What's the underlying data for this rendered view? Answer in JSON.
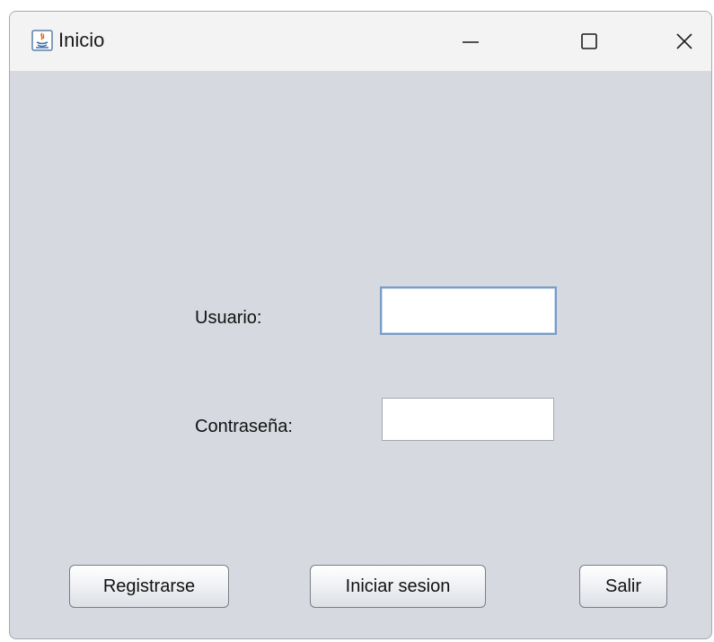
{
  "window": {
    "title": "Inicio",
    "icon": "java-icon",
    "controls": {
      "minimize": "minimize-icon",
      "maximize": "maximize-icon",
      "close": "close-icon"
    }
  },
  "form": {
    "user_label": "Usuario:",
    "user_value": "",
    "password_label": "Contraseña:",
    "password_value": ""
  },
  "buttons": {
    "register": "Registrarse",
    "login": "Iniciar sesion",
    "exit": "Salir"
  },
  "colors": {
    "window_background": "#d6d9e0",
    "titlebar_background": "#f3f3f3",
    "focus_border": "#7a9cc6"
  }
}
